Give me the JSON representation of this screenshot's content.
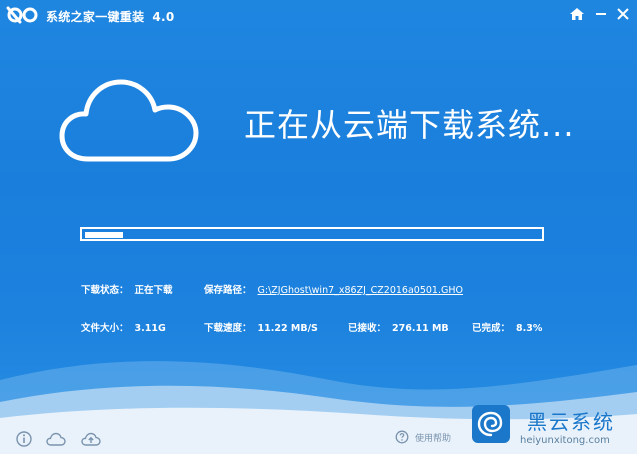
{
  "window": {
    "app_name": "系统之家一键重装",
    "version": "4.0"
  },
  "main": {
    "heading": "正在从云端下载系统..."
  },
  "progress": {
    "fraction": 0.083
  },
  "info": {
    "status_label": "下载状态：",
    "status_value": "正在下载",
    "path_label": "保存路径：",
    "path_value": "G:\\ZJGhost\\win7_x86ZJ_CZ2016a0501.GHO",
    "filesize_label": "文件大小：",
    "filesize_value": "3.11G",
    "speed_label": "下载速度：",
    "speed_value": "11.22 MB/S",
    "received_label": "已接收：",
    "received_value": "276.11 MB",
    "completed_label": "已完成：",
    "completed_value": "8.3%"
  },
  "footer": {
    "help_label": "使用帮助"
  },
  "watermark": {
    "title": "黑云系统",
    "url": "heiyunxitong.com"
  },
  "icons": {
    "logo": "app-logo-icon",
    "home": "home-icon",
    "minimize": "minimize-icon",
    "close": "close-icon",
    "cloud": "cloud-icon",
    "info": "info-icon",
    "cloud_small": "cloud-small-icon",
    "cloud_upload": "cloud-upload-icon",
    "help": "help-icon"
  },
  "colors": {
    "background": "#1f86e0",
    "accent_white": "#ffffff",
    "watermark": "#1b77c9"
  }
}
